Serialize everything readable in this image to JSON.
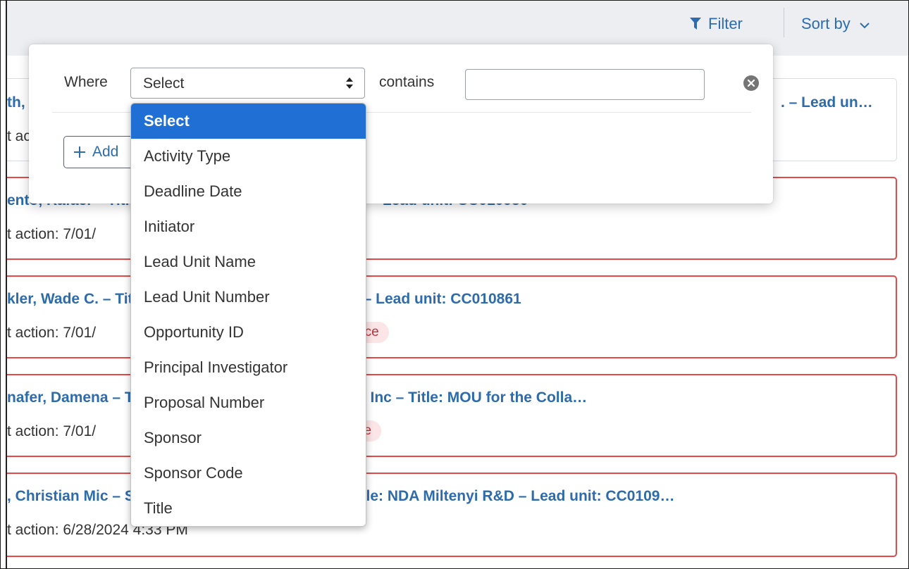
{
  "toolbar": {
    "filter_label": "Filter",
    "sort_label": "Sort by"
  },
  "rows": [
    {
      "title": "th,",
      "title_right": ". – Lead un…",
      "meta": "t ac"
    },
    {
      "title": "ento, Rafael – Title: ... Prince George's County Te… – Lead unit: CC010950",
      "meta": "t action: 7/01/"
    },
    {
      "title": "kler, Wade C. – Title: MTA for plasmids - Addgen… – Lead unit: CC010861",
      "meta": "t action: 7/01/",
      "badge": "nce"
    },
    {
      "title": "nafer, Damena – Title: Kansas Center for Research, Inc – Title: MOU for the Colla…",
      "meta": "t action: 7/01/",
      "badge": "ce"
    },
    {
      "title": ", Christian Mic – Sponsor: Miltenyi Biotec, Inc. – Title: NDA Miltenyi R&D – Lead unit: CC0109…",
      "meta": "t action: 6/28/2024 4:33 PM"
    }
  ],
  "filter": {
    "where_label": "Where",
    "select_value": "Select",
    "contains_label": "contains",
    "input_value": "",
    "add_label": "Add"
  },
  "dropdown": {
    "options": [
      "Select",
      "Activity Type",
      "Deadline Date",
      "Initiator",
      "Lead Unit Name",
      "Lead Unit Number",
      "Opportunity ID",
      "Principal Investigator",
      "Proposal Number",
      "Sponsor",
      "Sponsor Code",
      "Title"
    ],
    "selected": "Select"
  }
}
